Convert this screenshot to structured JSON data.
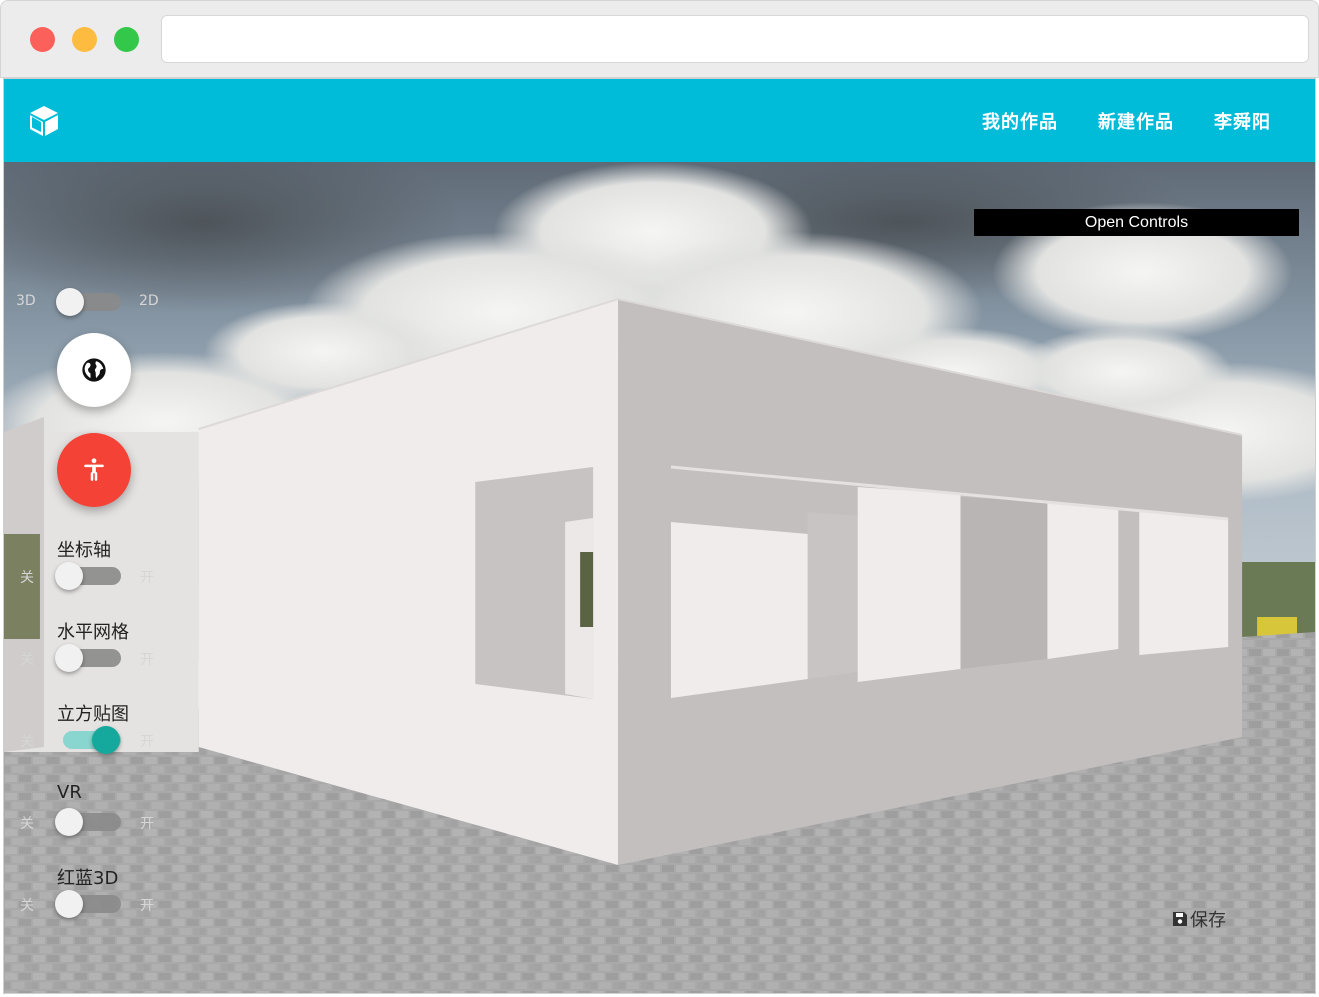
{
  "browser": {
    "url": ""
  },
  "header": {
    "logo_icon": "cube-icon",
    "nav": [
      "我的作品",
      "新建作品",
      "李舜阳"
    ],
    "background": "#00bcd8"
  },
  "view_mode": {
    "left": "3D",
    "right": "2D",
    "value": "3D"
  },
  "buttons": {
    "globe_icon": "globe-icon",
    "person_icon": "accessibility-person-icon"
  },
  "toggles": [
    {
      "title": "坐标轴",
      "off": "关",
      "on": "开",
      "checked": false
    },
    {
      "title": "水平网格",
      "off": "关",
      "on": "开",
      "checked": false
    },
    {
      "title": "立方贴图",
      "off": "关",
      "on": "开",
      "checked": true
    },
    {
      "title": "VR",
      "off": "关",
      "on": "开",
      "checked": false
    },
    {
      "title": "红蓝3D",
      "off": "关",
      "on": "开",
      "checked": false
    }
  ],
  "controls_panel": {
    "label": "Open Controls"
  },
  "save": {
    "icon": "floppy-disk-icon",
    "label": "保存"
  },
  "colors": {
    "accent": "#00bcd8",
    "fab_red": "#f44336",
    "toggle_on": "#14a99c"
  }
}
